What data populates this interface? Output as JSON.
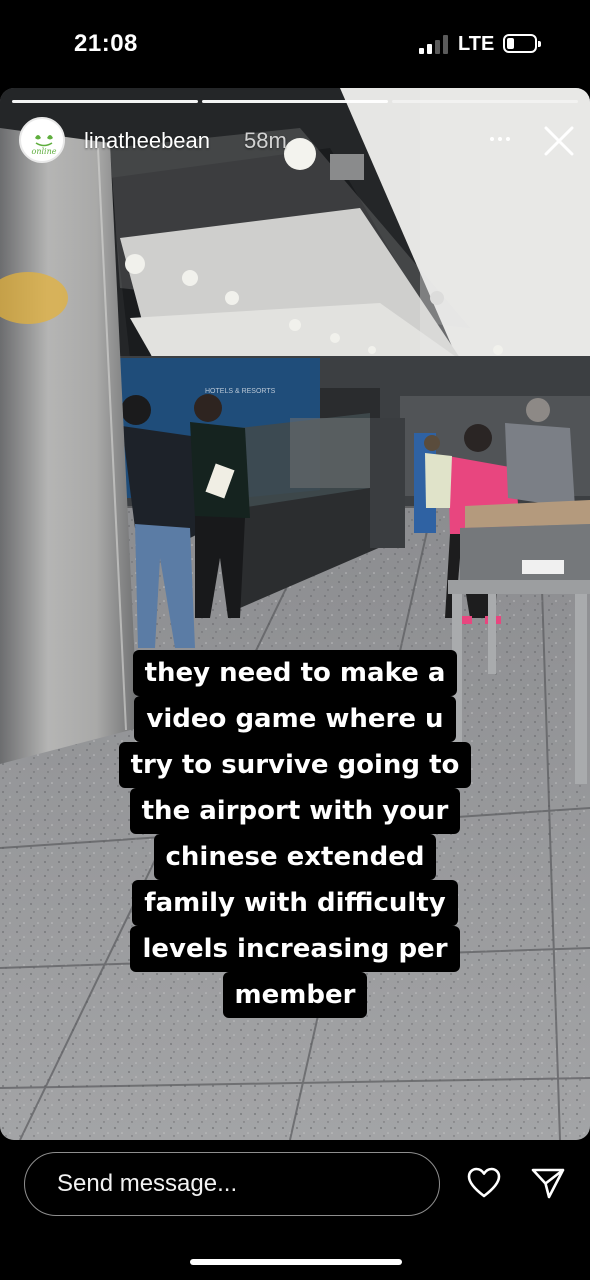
{
  "status_bar": {
    "time": "21:08",
    "network": "LTE",
    "signal_bars": 4,
    "signal_active": 2,
    "battery_level": 0.2
  },
  "story": {
    "progress_segments": 3,
    "progress_current": 2,
    "user": {
      "avatar_text": "online",
      "username": "linatheebean",
      "time_ago": "58m"
    },
    "caption_lines": [
      "they need to make a",
      "video game where u",
      "try to survive going to",
      "the airport with your",
      "chinese extended",
      "family with difficulty",
      "levels increasing per",
      "member"
    ],
    "photo_text": "HOTELS & RESORTS",
    "more_icon": "more-horizontal-icon",
    "close_icon": "close-icon"
  },
  "composer": {
    "placeholder": "Send message...",
    "like_icon": "heart-icon",
    "send_icon": "send-icon"
  },
  "colors": {
    "background": "#000000",
    "avatar_green": "#5fae3e",
    "sweater_pink": "#e8467f",
    "wall_blue": "#1f4d7a"
  }
}
